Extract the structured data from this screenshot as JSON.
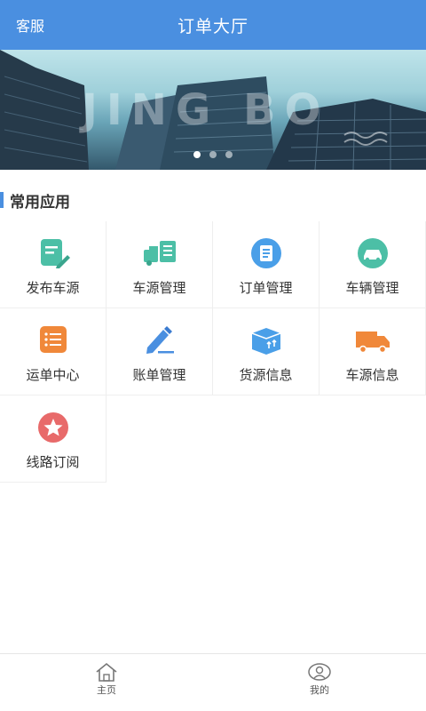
{
  "header": {
    "left_label": "客服",
    "title": "订单大厅"
  },
  "banner": {
    "watermark": "JING BO",
    "active_index": 0,
    "dot_count": 3
  },
  "section": {
    "title": "常用应用"
  },
  "apps": [
    {
      "label": "发布车源",
      "icon": "edit-document-icon",
      "color": "#4cbfa6"
    },
    {
      "label": "车源管理",
      "icon": "truck-list-icon",
      "color": "#4cbfa6"
    },
    {
      "label": "订单管理",
      "icon": "clipboard-icon",
      "color": "#4a9fe8"
    },
    {
      "label": "车辆管理",
      "icon": "car-icon",
      "color": "#4cbfa6"
    },
    {
      "label": "运单中心",
      "icon": "list-icon",
      "color": "#f0883a"
    },
    {
      "label": "账单管理",
      "icon": "pen-icon",
      "color": "#4a8fe0"
    },
    {
      "label": "货源信息",
      "icon": "package-icon",
      "color": "#4a9fe8"
    },
    {
      "label": "车源信息",
      "icon": "delivery-truck-icon",
      "color": "#f0883a"
    },
    {
      "label": "线路订阅",
      "icon": "star-icon",
      "color": "#e86a6a"
    }
  ],
  "tabbar": {
    "home": "主页",
    "mine": "我的"
  }
}
